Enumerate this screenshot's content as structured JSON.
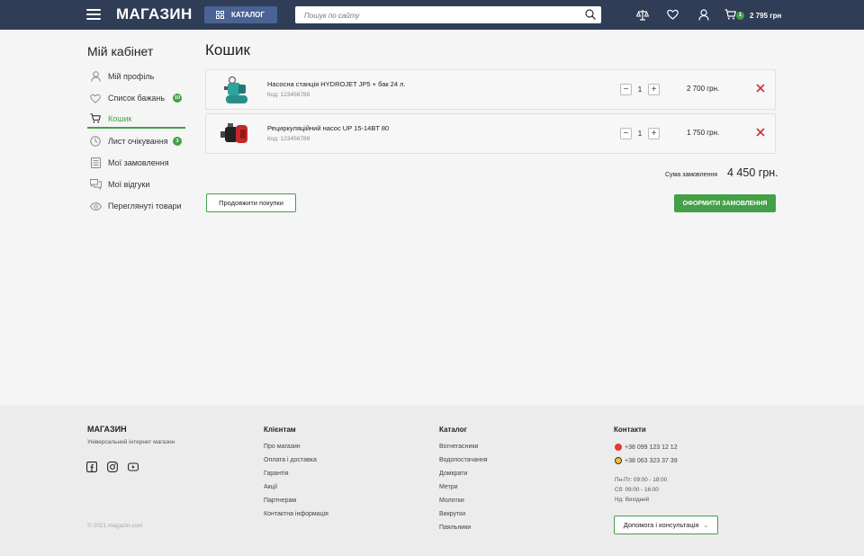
{
  "header": {
    "logo": "МАГАЗИН",
    "catalog_label": "КАТАЛОГ",
    "search_placeholder": "Пошук по сайту",
    "cart_count": "1",
    "cart_total": "2 795 грн"
  },
  "sidebar": {
    "title": "Мій кабінет",
    "items": [
      {
        "label": "Мій профіль",
        "icon": "user-icon"
      },
      {
        "label": "Список бажань",
        "icon": "heart-icon",
        "badge": "10"
      },
      {
        "label": "Кошик",
        "icon": "cart-icon",
        "active": true
      },
      {
        "label": "Лист очікування",
        "icon": "clock-icon",
        "badge": "3"
      },
      {
        "label": "Мої замовлення",
        "icon": "list-icon"
      },
      {
        "label": "Мої відгуки",
        "icon": "comments-icon"
      },
      {
        "label": "Переглянуті товари",
        "icon": "eye-icon"
      }
    ]
  },
  "main": {
    "title": "Кошик",
    "items": [
      {
        "name": "Насосна станція HYDROJET JP5 + бак 24 л.",
        "code": "Код: 123456789",
        "qty": "1",
        "price": "2 700 грн."
      },
      {
        "name": "Рециркуляційний насос UP 15-14BT 80",
        "code": "Код: 123456789",
        "qty": "1",
        "price": "1 750 грн."
      }
    ],
    "sum_label": "Сума замовлення",
    "sum_value": "4 450 грн.",
    "continue_label": "Продовжити покупки",
    "order_label": "ОФОРМИТИ ЗАМОВЛЕННЯ"
  },
  "footer": {
    "logo": "МАГАЗИН",
    "subtitle": "Універсальний інтернет магазин",
    "copyright": "© 2021 magazin.com",
    "clients": {
      "title": "Клієнтам",
      "links": [
        "Про магазин",
        "Оплата і доставка",
        "Гарантія",
        "Акції",
        "Партнерам",
        "Контактна інформація"
      ]
    },
    "catalog": {
      "title": "Каталог",
      "links": [
        "Вогнегасники",
        "Водопостачання",
        "Домкрати",
        "Метри",
        "Молотки",
        "Викрутки",
        "Паяльники"
      ]
    },
    "contacts": {
      "title": "Контакти",
      "phones": [
        "+38 099 123 12 12",
        "+38 063 323 37 39"
      ],
      "hours": [
        "Пн-Пт: 09:00 - 18:00",
        "Сб: 09:00 - 16:00",
        "Нд: Вихідний"
      ],
      "help_label": "Допомога і консультація"
    }
  },
  "colors": {
    "header_bg": "#2f3d56",
    "accent_green": "#43a047",
    "remove_red": "#d32f2f"
  }
}
